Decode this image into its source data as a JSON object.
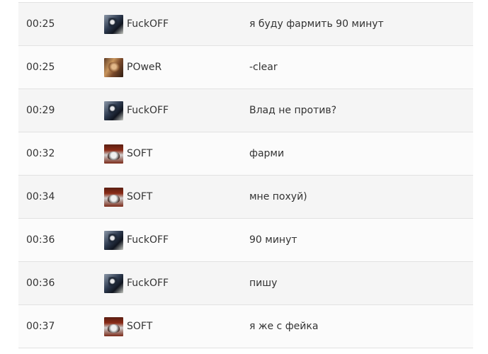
{
  "chat": {
    "rows": [
      {
        "time": "00:25",
        "user": "FuckOFF",
        "message": "я буду фармить 90 минут"
      },
      {
        "time": "00:25",
        "user": "POweR",
        "message": "-clear"
      },
      {
        "time": "00:29",
        "user": "FuckOFF",
        "message": "Влад не против?"
      },
      {
        "time": "00:32",
        "user": "SOFT",
        "message": "фарми"
      },
      {
        "time": "00:34",
        "user": "SOFT",
        "message": "мне похуй)"
      },
      {
        "time": "00:36",
        "user": "FuckOFF",
        "message": "90 минут"
      },
      {
        "time": "00:36",
        "user": "FuckOFF",
        "message": "пишу"
      },
      {
        "time": "00:37",
        "user": "SOFT",
        "message": "я же с фейка"
      }
    ]
  }
}
